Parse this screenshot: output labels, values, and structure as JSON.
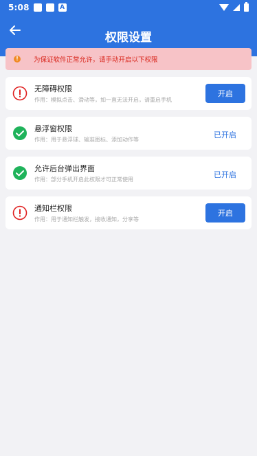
{
  "statusbar": {
    "time": "5:08",
    "notif_a": "A"
  },
  "appbar": {
    "title": "权限设置"
  },
  "warning": {
    "text": "为保证软件正常允许，请手动开启以下权限"
  },
  "permissions": [
    {
      "title": "无障碍权限",
      "desc": "作用：模拟点击、滑动等，如一直无法开启，请重启手机",
      "state": "button",
      "action_label": "开启"
    },
    {
      "title": "悬浮窗权限",
      "desc": "作用：用于悬浮球、输准图标、添加动作等",
      "state": "enabled",
      "action_label": "已开启"
    },
    {
      "title": "允许后台弹出界面",
      "desc": "作用：部分手机开启此权限才可正常使用",
      "state": "enabled",
      "action_label": "已开启"
    },
    {
      "title": "通知栏权限",
      "desc": "作用：用于通知栏触发，接收通知，分享等",
      "state": "button",
      "action_label": "开启"
    }
  ],
  "colors": {
    "primary": "#2d73e0",
    "warning_bg": "#f7c3c7",
    "warning_text": "#d9261c",
    "warning_icon": "#f08a24",
    "error_icon": "#e02020",
    "success_icon": "#1fb35b"
  }
}
